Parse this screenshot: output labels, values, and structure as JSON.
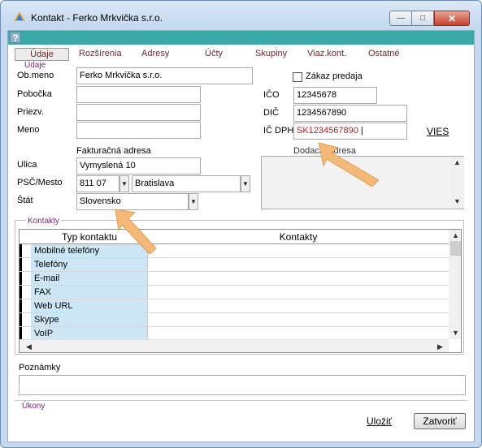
{
  "window": {
    "title": "Kontakt - Ferko Mrkvička s.r.o.",
    "controls": {
      "minimize": "—",
      "maximize": "□",
      "close": "✕"
    },
    "help": "?"
  },
  "tabs": [
    {
      "label": "Údaje",
      "active": true
    },
    {
      "label": "Rozšírenia",
      "active": false
    },
    {
      "label": "Adresy",
      "active": false
    },
    {
      "label": "Účty",
      "active": false
    },
    {
      "label": "Skupiny",
      "active": false
    },
    {
      "label": "Viaz.kont.",
      "active": false
    },
    {
      "label": "Ostatné",
      "active": false
    }
  ],
  "sections": {
    "udaje": "Údaje",
    "kontakty": "Kontakty",
    "ukony": "Úkony"
  },
  "form": {
    "obmeno_label": "Ob.meno",
    "obmeno_value": "Ferko Mrkvička s.r.o.",
    "pobocka_label": "Pobočka",
    "pobocka_value": "",
    "priezv_label": "Priezv.",
    "priezv_value": "",
    "meno_label": "Meno",
    "meno_value": "",
    "zakaz_label": "Zákaz predaja",
    "ico_label": "IČO",
    "ico_value": "12345678",
    "dic_label": "DIČ",
    "dic_value": "1234567890",
    "icdph_label": "IČ DPH",
    "icdph_value": "SK1234567890",
    "vies": "VIES",
    "fakt_adresa_label": "Fakturačná adresa",
    "dodacia_label": "Dodacia adresa",
    "ulica_label": "Ulica",
    "ulica_value": "Vymyslená 10",
    "psc_label": "PSČ/Mesto",
    "psc_value": "811 07",
    "mesto_value": "Bratislava",
    "stat_label": "Štát",
    "stat_value": "Slovensko"
  },
  "contacts": {
    "headers": [
      "Typ kontaktu",
      "Kontakty"
    ],
    "rows": [
      {
        "type": "Mobilné telefóny",
        "value": ""
      },
      {
        "type": "Telefóny",
        "value": ""
      },
      {
        "type": "E-mail",
        "value": ""
      },
      {
        "type": "FAX",
        "value": ""
      },
      {
        "type": "Web URL",
        "value": ""
      },
      {
        "type": "Skype",
        "value": ""
      },
      {
        "type": "VoIP",
        "value": ""
      }
    ]
  },
  "notes": {
    "label": "Poznámky",
    "value": ""
  },
  "actions": {
    "save": "Uložiť",
    "close": "Zatvoriť"
  },
  "colors": {
    "accent_bar": "#3aa9a7",
    "section_label": "#7a1f7a",
    "tab_text": "#6b2c2c",
    "row_type_bg": "#cde6f5",
    "highlight_arrow": "#f4b978",
    "icdph_text": "#c4161c"
  }
}
